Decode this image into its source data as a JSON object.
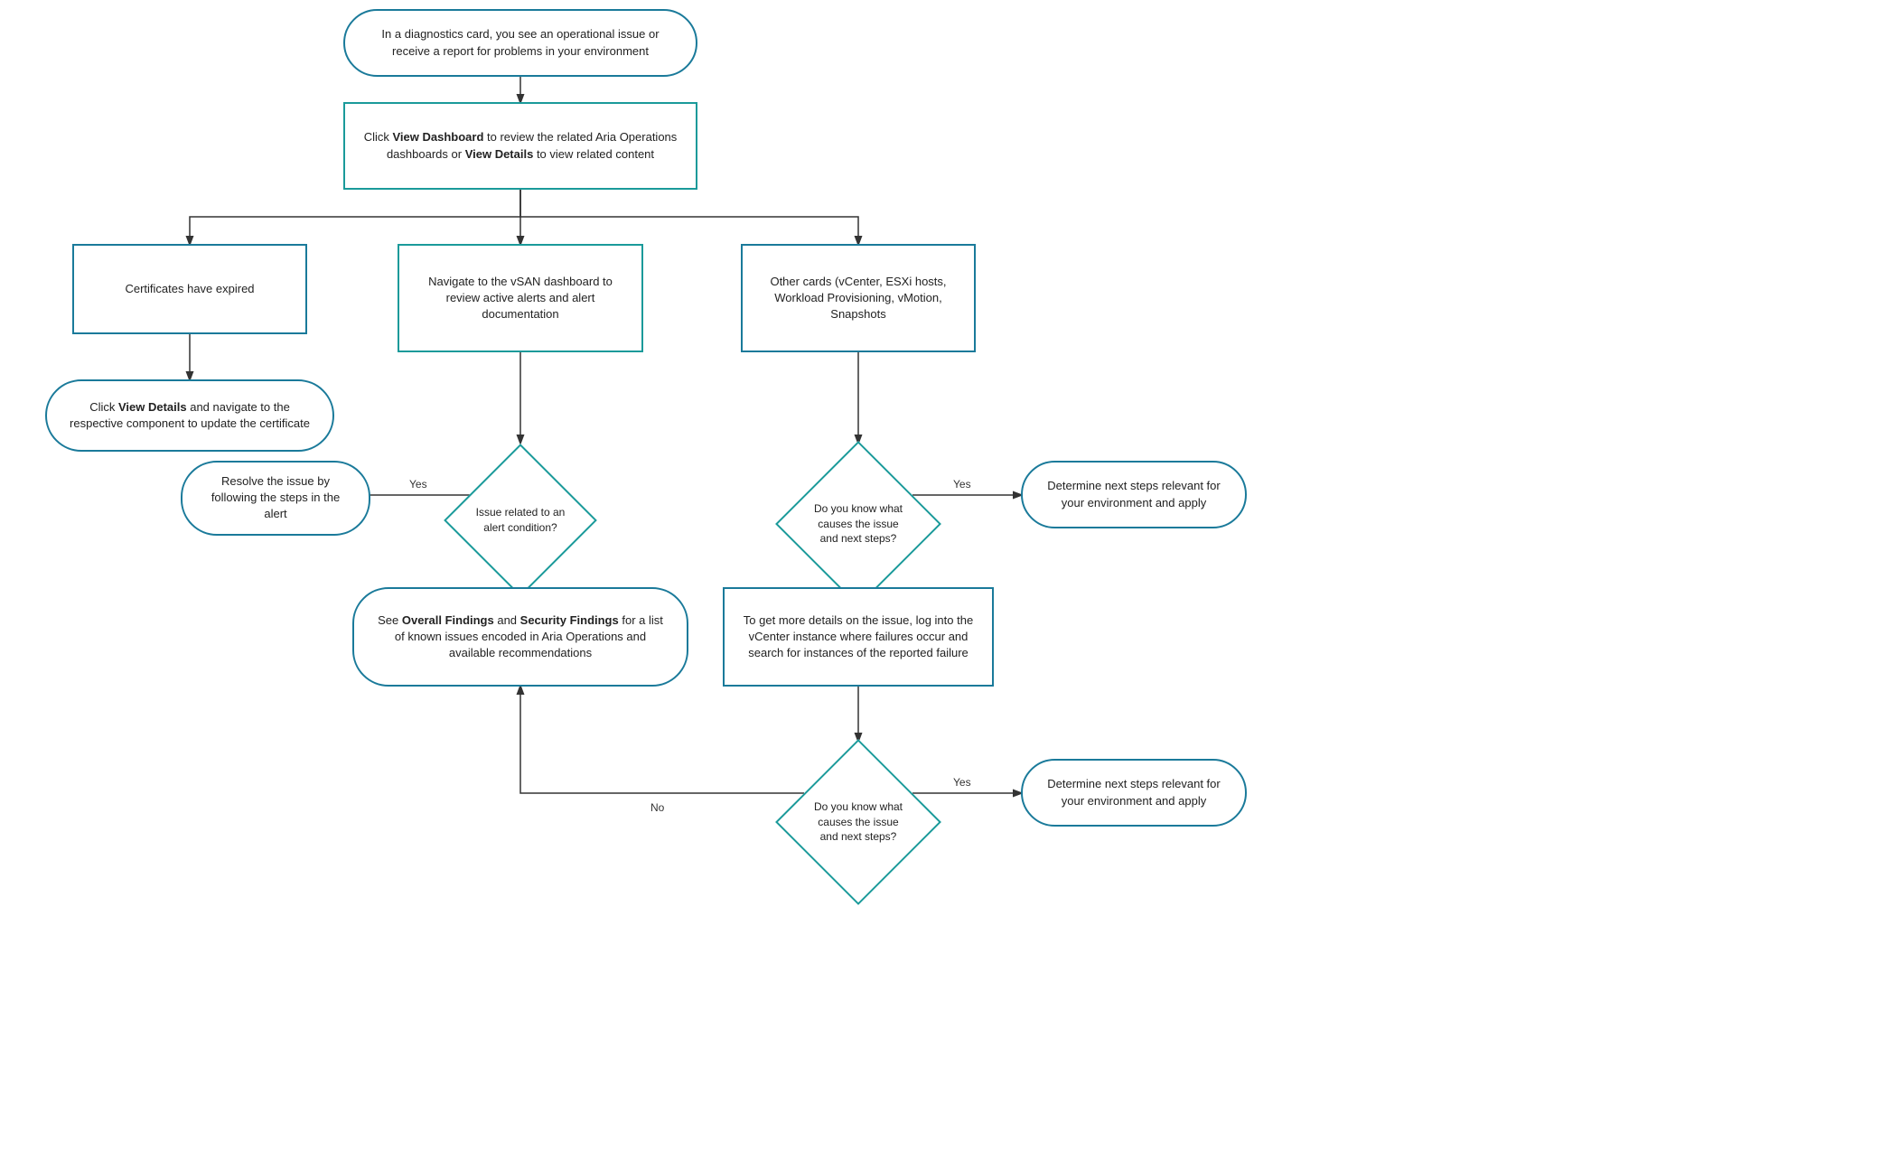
{
  "nodes": {
    "start": {
      "text": "In a diagnostics card, you see an operational issue or receive a report for problems in your environment"
    },
    "dashboard": {
      "text_prefix": "Click ",
      "bold1": "View Dashboard",
      "text_mid": " to review the related Aria Operations dashboards or ",
      "bold2": "View Details",
      "text_suffix": " to view related content"
    },
    "cert_expired": {
      "text": "Certificates have expired"
    },
    "cert_action": {
      "text_prefix": "Click ",
      "bold": "View Details",
      "text_suffix": " and navigate to the respective component to update the certificate"
    },
    "vsan": {
      "text": "Navigate to the vSAN dashboard to review active alerts and alert documentation"
    },
    "other_cards": {
      "text": "Other cards (vCenter, ESXi hosts, Workload Provisioning, vMotion, Snapshots"
    },
    "alert_diamond": {
      "text": "Issue related to an alert condition?"
    },
    "resolve_alert": {
      "text": "Resolve the issue by following the steps in the alert"
    },
    "overall_findings": {
      "text_prefix": "See ",
      "bold1": "Overall Findings",
      "text_mid": " and ",
      "bold2": "Security Findings",
      "text_suffix": " for a list of known issues encoded in Aria Operations and available recommendations"
    },
    "know_cause1": {
      "text": "Do you know what causes the issue and next steps?"
    },
    "determine1": {
      "text": "Determine next steps relevant for your environment and apply"
    },
    "vcenter_details": {
      "text": "To get more details on the issue, log into the vCenter instance where failures occur and search for instances of the reported failure"
    },
    "know_cause2": {
      "text": "Do you know what causes the issue and next steps?"
    },
    "determine2": {
      "text": "Determine next steps relevant for your environment and apply"
    }
  },
  "labels": {
    "yes": "Yes",
    "no": "No"
  }
}
